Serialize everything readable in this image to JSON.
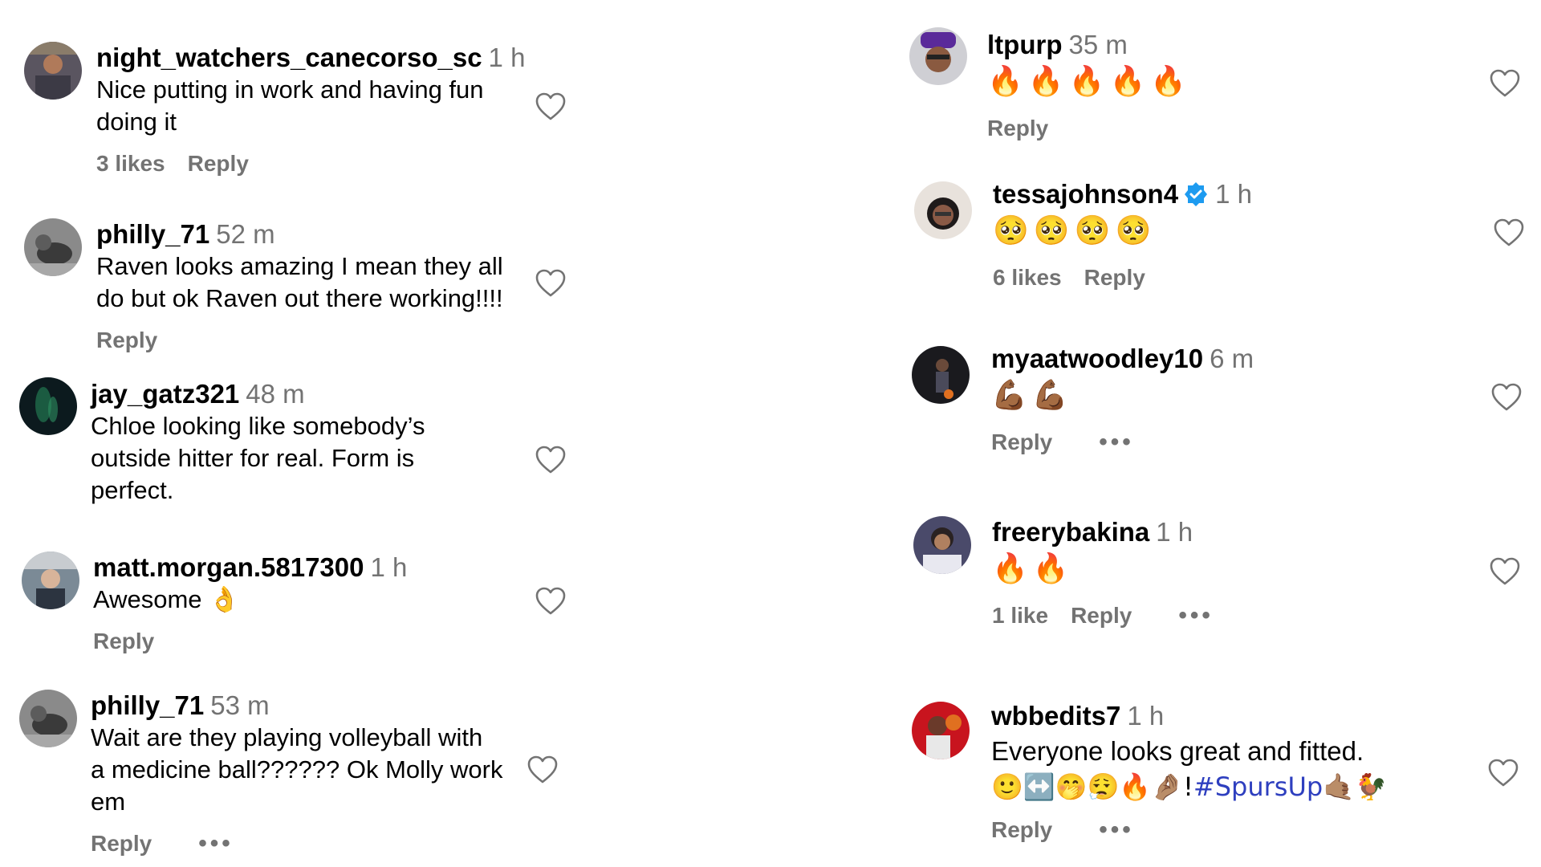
{
  "colors": {
    "username": "#000000",
    "muted": "#737373",
    "hashtag": "#2e3fbf",
    "verified": "#1d9bf0"
  },
  "left": [
    {
      "username": "night_watchers_canecorso_sc",
      "time": "1 h",
      "lines": [
        "Nice putting in work and having fun",
        "doing it"
      ],
      "likes": "3 likes",
      "reply": "Reply",
      "dots": ""
    },
    {
      "username": "philly_71",
      "time": "52 m",
      "lines": [
        "Raven looks amazing I mean they all",
        "do but ok Raven out there working!!!!"
      ],
      "likes": "",
      "reply": "Reply",
      "dots": ""
    },
    {
      "username": "jay_gatz321",
      "time": "48 m",
      "lines": [
        "Chloe looking like somebody’s",
        "outside hitter for real. Form is",
        "perfect."
      ],
      "likes": "",
      "reply": "",
      "dots": ""
    },
    {
      "username": "matt.morgan.5817300",
      "time": "1 h",
      "lines": [
        "Awesome 👌"
      ],
      "likes": "",
      "reply": "Reply",
      "dots": ""
    },
    {
      "username": "philly_71",
      "time": "53 m",
      "lines": [
        "Wait are they playing volleyball with",
        "a medicine ball?????? Ok Molly work",
        "em"
      ],
      "likes": "",
      "reply": "Reply",
      "dots": "•••"
    }
  ],
  "right": [
    {
      "username": "ltpurp",
      "time": "35 m",
      "emoji": "🔥🔥🔥🔥🔥",
      "likes": "",
      "reply": "Reply",
      "dots": ""
    },
    {
      "username": "tessajohnson4",
      "verified": true,
      "time": "1 h",
      "emoji": "🥺🥺🥺🥺",
      "likes": "6 likes",
      "reply": "Reply",
      "dots": ""
    },
    {
      "username": "myaatwoodley10",
      "time": "6 m",
      "emoji": "💪🏾💪🏾",
      "likes": "",
      "reply": "Reply",
      "dots": "•••"
    },
    {
      "username": "freerybakina",
      "time": "1 h",
      "emoji": "🔥🔥",
      "likes": "1 like",
      "reply": "Reply",
      "dots": "•••"
    },
    {
      "username": "wbbedits7",
      "time": "1 h",
      "line1": "Everyone looks great and fitted.",
      "line2_emoji": "🙂↔️🤭😮‍💨🔥🤌🏽!",
      "hashtag": "#SpursUp",
      "line2_tail": "🤙🏽🐓",
      "likes": "",
      "reply": "Reply",
      "dots": "•••"
    }
  ]
}
